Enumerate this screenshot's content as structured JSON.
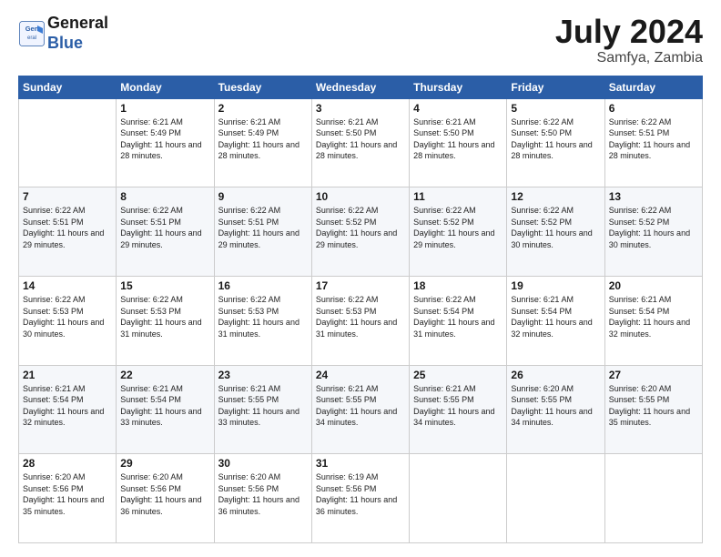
{
  "logo": {
    "line1": "General",
    "line2": "Blue"
  },
  "title": "July 2024",
  "location": "Samfya, Zambia",
  "days_header": [
    "Sunday",
    "Monday",
    "Tuesday",
    "Wednesday",
    "Thursday",
    "Friday",
    "Saturday"
  ],
  "weeks": [
    [
      {
        "day": "",
        "sunrise": "",
        "sunset": "",
        "daylight": ""
      },
      {
        "day": "1",
        "sunrise": "Sunrise: 6:21 AM",
        "sunset": "Sunset: 5:49 PM",
        "daylight": "Daylight: 11 hours and 28 minutes."
      },
      {
        "day": "2",
        "sunrise": "Sunrise: 6:21 AM",
        "sunset": "Sunset: 5:49 PM",
        "daylight": "Daylight: 11 hours and 28 minutes."
      },
      {
        "day": "3",
        "sunrise": "Sunrise: 6:21 AM",
        "sunset": "Sunset: 5:50 PM",
        "daylight": "Daylight: 11 hours and 28 minutes."
      },
      {
        "day": "4",
        "sunrise": "Sunrise: 6:21 AM",
        "sunset": "Sunset: 5:50 PM",
        "daylight": "Daylight: 11 hours and 28 minutes."
      },
      {
        "day": "5",
        "sunrise": "Sunrise: 6:22 AM",
        "sunset": "Sunset: 5:50 PM",
        "daylight": "Daylight: 11 hours and 28 minutes."
      },
      {
        "day": "6",
        "sunrise": "Sunrise: 6:22 AM",
        "sunset": "Sunset: 5:51 PM",
        "daylight": "Daylight: 11 hours and 28 minutes."
      }
    ],
    [
      {
        "day": "7",
        "sunrise": "Sunrise: 6:22 AM",
        "sunset": "Sunset: 5:51 PM",
        "daylight": "Daylight: 11 hours and 29 minutes."
      },
      {
        "day": "8",
        "sunrise": "Sunrise: 6:22 AM",
        "sunset": "Sunset: 5:51 PM",
        "daylight": "Daylight: 11 hours and 29 minutes."
      },
      {
        "day": "9",
        "sunrise": "Sunrise: 6:22 AM",
        "sunset": "Sunset: 5:51 PM",
        "daylight": "Daylight: 11 hours and 29 minutes."
      },
      {
        "day": "10",
        "sunrise": "Sunrise: 6:22 AM",
        "sunset": "Sunset: 5:52 PM",
        "daylight": "Daylight: 11 hours and 29 minutes."
      },
      {
        "day": "11",
        "sunrise": "Sunrise: 6:22 AM",
        "sunset": "Sunset: 5:52 PM",
        "daylight": "Daylight: 11 hours and 29 minutes."
      },
      {
        "day": "12",
        "sunrise": "Sunrise: 6:22 AM",
        "sunset": "Sunset: 5:52 PM",
        "daylight": "Daylight: 11 hours and 30 minutes."
      },
      {
        "day": "13",
        "sunrise": "Sunrise: 6:22 AM",
        "sunset": "Sunset: 5:52 PM",
        "daylight": "Daylight: 11 hours and 30 minutes."
      }
    ],
    [
      {
        "day": "14",
        "sunrise": "Sunrise: 6:22 AM",
        "sunset": "Sunset: 5:53 PM",
        "daylight": "Daylight: 11 hours and 30 minutes."
      },
      {
        "day": "15",
        "sunrise": "Sunrise: 6:22 AM",
        "sunset": "Sunset: 5:53 PM",
        "daylight": "Daylight: 11 hours and 31 minutes."
      },
      {
        "day": "16",
        "sunrise": "Sunrise: 6:22 AM",
        "sunset": "Sunset: 5:53 PM",
        "daylight": "Daylight: 11 hours and 31 minutes."
      },
      {
        "day": "17",
        "sunrise": "Sunrise: 6:22 AM",
        "sunset": "Sunset: 5:53 PM",
        "daylight": "Daylight: 11 hours and 31 minutes."
      },
      {
        "day": "18",
        "sunrise": "Sunrise: 6:22 AM",
        "sunset": "Sunset: 5:54 PM",
        "daylight": "Daylight: 11 hours and 31 minutes."
      },
      {
        "day": "19",
        "sunrise": "Sunrise: 6:21 AM",
        "sunset": "Sunset: 5:54 PM",
        "daylight": "Daylight: 11 hours and 32 minutes."
      },
      {
        "day": "20",
        "sunrise": "Sunrise: 6:21 AM",
        "sunset": "Sunset: 5:54 PM",
        "daylight": "Daylight: 11 hours and 32 minutes."
      }
    ],
    [
      {
        "day": "21",
        "sunrise": "Sunrise: 6:21 AM",
        "sunset": "Sunset: 5:54 PM",
        "daylight": "Daylight: 11 hours and 32 minutes."
      },
      {
        "day": "22",
        "sunrise": "Sunrise: 6:21 AM",
        "sunset": "Sunset: 5:54 PM",
        "daylight": "Daylight: 11 hours and 33 minutes."
      },
      {
        "day": "23",
        "sunrise": "Sunrise: 6:21 AM",
        "sunset": "Sunset: 5:55 PM",
        "daylight": "Daylight: 11 hours and 33 minutes."
      },
      {
        "day": "24",
        "sunrise": "Sunrise: 6:21 AM",
        "sunset": "Sunset: 5:55 PM",
        "daylight": "Daylight: 11 hours and 34 minutes."
      },
      {
        "day": "25",
        "sunrise": "Sunrise: 6:21 AM",
        "sunset": "Sunset: 5:55 PM",
        "daylight": "Daylight: 11 hours and 34 minutes."
      },
      {
        "day": "26",
        "sunrise": "Sunrise: 6:20 AM",
        "sunset": "Sunset: 5:55 PM",
        "daylight": "Daylight: 11 hours and 34 minutes."
      },
      {
        "day": "27",
        "sunrise": "Sunrise: 6:20 AM",
        "sunset": "Sunset: 5:55 PM",
        "daylight": "Daylight: 11 hours and 35 minutes."
      }
    ],
    [
      {
        "day": "28",
        "sunrise": "Sunrise: 6:20 AM",
        "sunset": "Sunset: 5:56 PM",
        "daylight": "Daylight: 11 hours and 35 minutes."
      },
      {
        "day": "29",
        "sunrise": "Sunrise: 6:20 AM",
        "sunset": "Sunset: 5:56 PM",
        "daylight": "Daylight: 11 hours and 36 minutes."
      },
      {
        "day": "30",
        "sunrise": "Sunrise: 6:20 AM",
        "sunset": "Sunset: 5:56 PM",
        "daylight": "Daylight: 11 hours and 36 minutes."
      },
      {
        "day": "31",
        "sunrise": "Sunrise: 6:19 AM",
        "sunset": "Sunset: 5:56 PM",
        "daylight": "Daylight: 11 hours and 36 minutes."
      },
      {
        "day": "",
        "sunrise": "",
        "sunset": "",
        "daylight": ""
      },
      {
        "day": "",
        "sunrise": "",
        "sunset": "",
        "daylight": ""
      },
      {
        "day": "",
        "sunrise": "",
        "sunset": "",
        "daylight": ""
      }
    ]
  ]
}
